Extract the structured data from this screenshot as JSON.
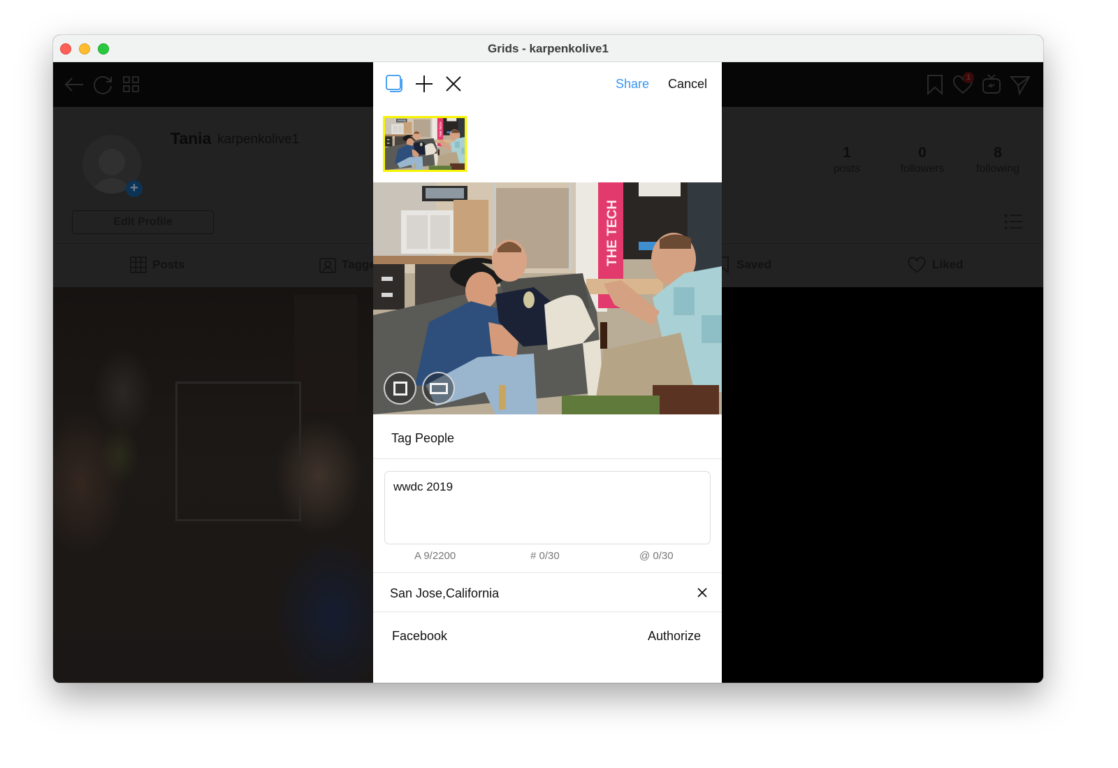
{
  "window": {
    "title": "Grids - karpenkolive1"
  },
  "toolbar": {
    "left_icons": [
      "back-arrow-icon",
      "refresh-icon",
      "grid-icon"
    ],
    "right_icons": [
      "bookmark-icon",
      "heart-icon",
      "igtv-icon",
      "send-icon"
    ],
    "notification_badge": "1"
  },
  "profile": {
    "display_name": "Tania",
    "username": "karpenkolive1",
    "edit_profile_label": "Edit Profile",
    "stats": [
      {
        "value": "1",
        "label": "posts"
      },
      {
        "value": "0",
        "label": "followers"
      },
      {
        "value": "8",
        "label": "following"
      }
    ],
    "tabs": [
      {
        "label": "Posts",
        "icon": "grid-icon"
      },
      {
        "label": "Tagged",
        "icon": "tagged-person-icon"
      },
      {
        "label": "Saved",
        "icon": "bookmark-icon"
      },
      {
        "label": "Liked",
        "icon": "heart-icon"
      }
    ]
  },
  "post_modal": {
    "icons": [
      "multi-select-icon",
      "add-icon",
      "remove-icon"
    ],
    "share_label": "Share",
    "cancel_label": "Cancel",
    "photo_sign_text": "THE TECH",
    "crop_options": [
      "square-crop",
      "original-crop"
    ],
    "tag_people_label": "Tag People",
    "caption_value": "wwdc 2019",
    "counters": {
      "characters": "A 9/2200",
      "hashtags": "# 0/30",
      "mentions": "@ 0/30"
    },
    "location": "San Jose,California",
    "facebook_label": "Facebook",
    "authorize_label": "Authorize"
  },
  "colors": {
    "accent": "#3897f0",
    "thumbnail_border": "#f7f400",
    "badge": "#c0151c"
  }
}
